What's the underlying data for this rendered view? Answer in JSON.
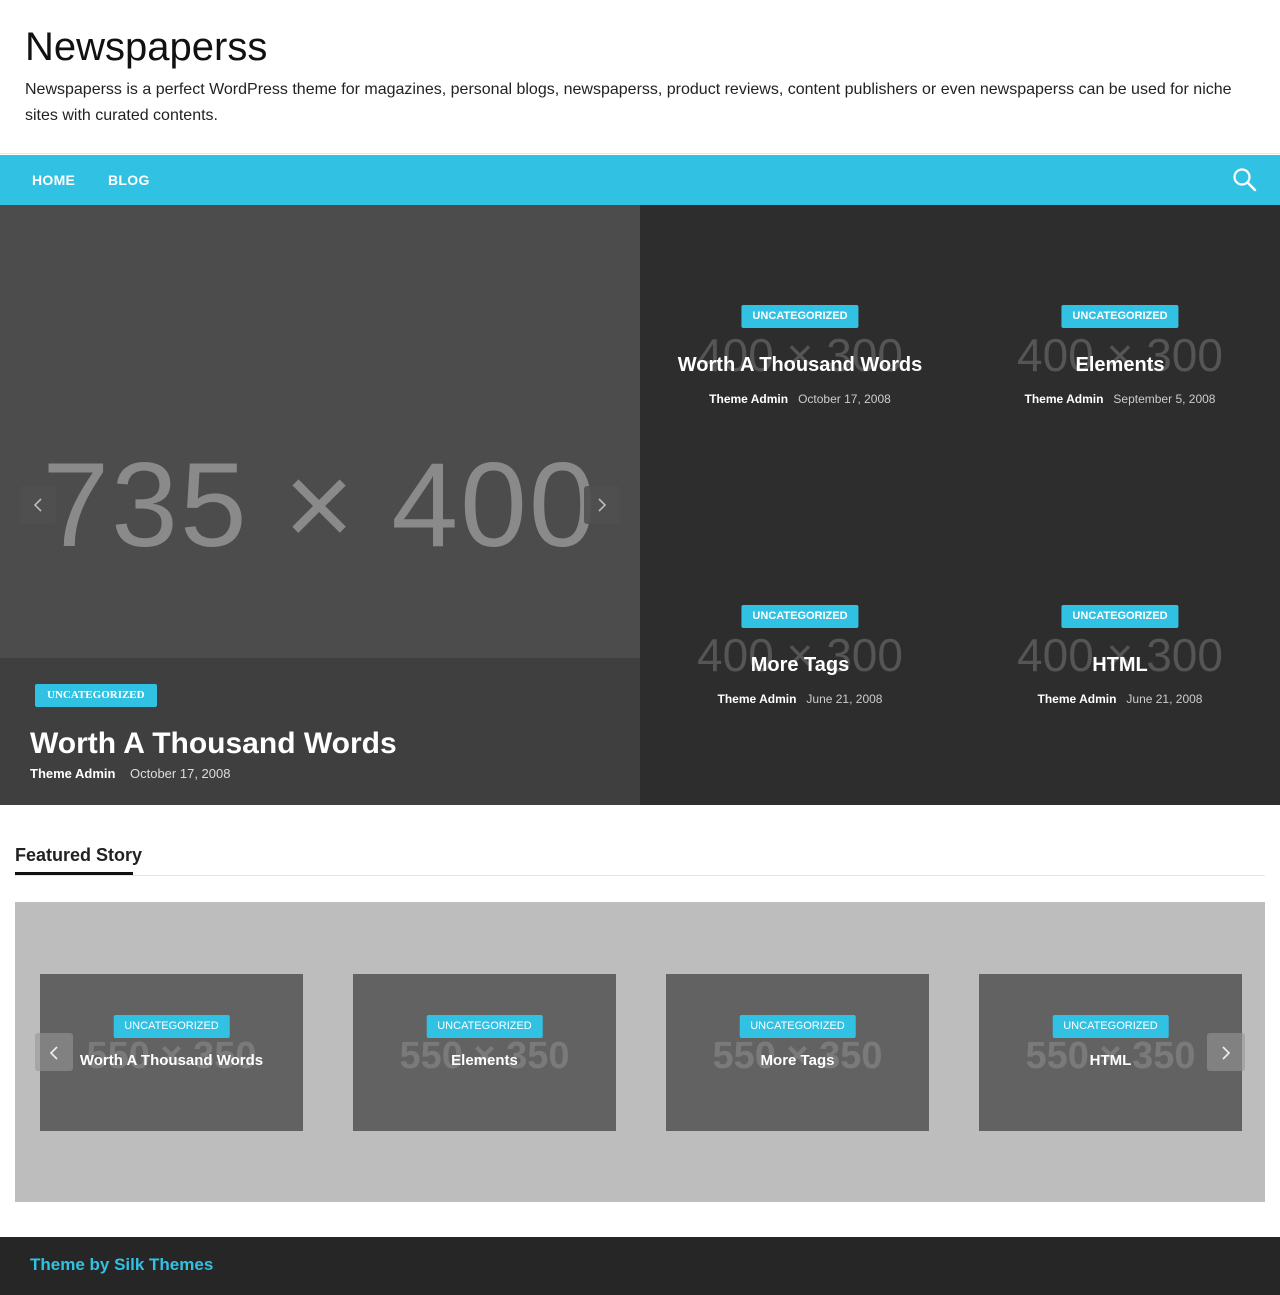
{
  "site": {
    "title": "Newspaperss",
    "description": "Newspaperss is a perfect WordPress theme for magazines, personal blogs, newspaperss, product reviews, content publishers or even newspaperss can be used for niche sites with curated contents."
  },
  "nav": {
    "items": [
      {
        "label": "HOME"
      },
      {
        "label": "BLOG"
      }
    ],
    "search_icon": "search-icon"
  },
  "hero": {
    "placeholder": "735 × 400",
    "category": "UNCATEGORIZED",
    "title": "Worth A Thousand Words",
    "author": "Theme Admin",
    "date": "October 17, 2008"
  },
  "grid": [
    {
      "placeholder": "400 × 300",
      "category": "UNCATEGORIZED",
      "title": "Worth A Thousand Words",
      "author": "Theme Admin",
      "date": "October 17, 2008"
    },
    {
      "placeholder": "400 × 300",
      "category": "UNCATEGORIZED",
      "title": "Elements",
      "author": "Theme Admin",
      "date": "September 5, 2008"
    },
    {
      "placeholder": "400 × 300",
      "category": "UNCATEGORIZED",
      "title": "More Tags",
      "author": "Theme Admin",
      "date": "June 21, 2008"
    },
    {
      "placeholder": "400 × 300",
      "category": "UNCATEGORIZED",
      "title": "HTML",
      "author": "Theme Admin",
      "date": "June 21, 2008"
    }
  ],
  "featured": {
    "heading": "Featured Story",
    "cards": [
      {
        "placeholder": "550 × 350",
        "category": "UNCATEGORIZED",
        "title": "Worth A Thousand Words"
      },
      {
        "placeholder": "550 × 350",
        "category": "UNCATEGORIZED",
        "title": "Elements"
      },
      {
        "placeholder": "550 × 350",
        "category": "UNCATEGORIZED",
        "title": "More Tags"
      },
      {
        "placeholder": "550 × 350",
        "category": "UNCATEGORIZED",
        "title": "HTML"
      }
    ]
  },
  "footer": {
    "credit": "Theme by Silk Themes"
  },
  "colors": {
    "accent": "#31c1e3",
    "hero_bg": "#4c4c4c",
    "grid_bg": "#2d2d2d",
    "footer_bg": "#262626"
  }
}
